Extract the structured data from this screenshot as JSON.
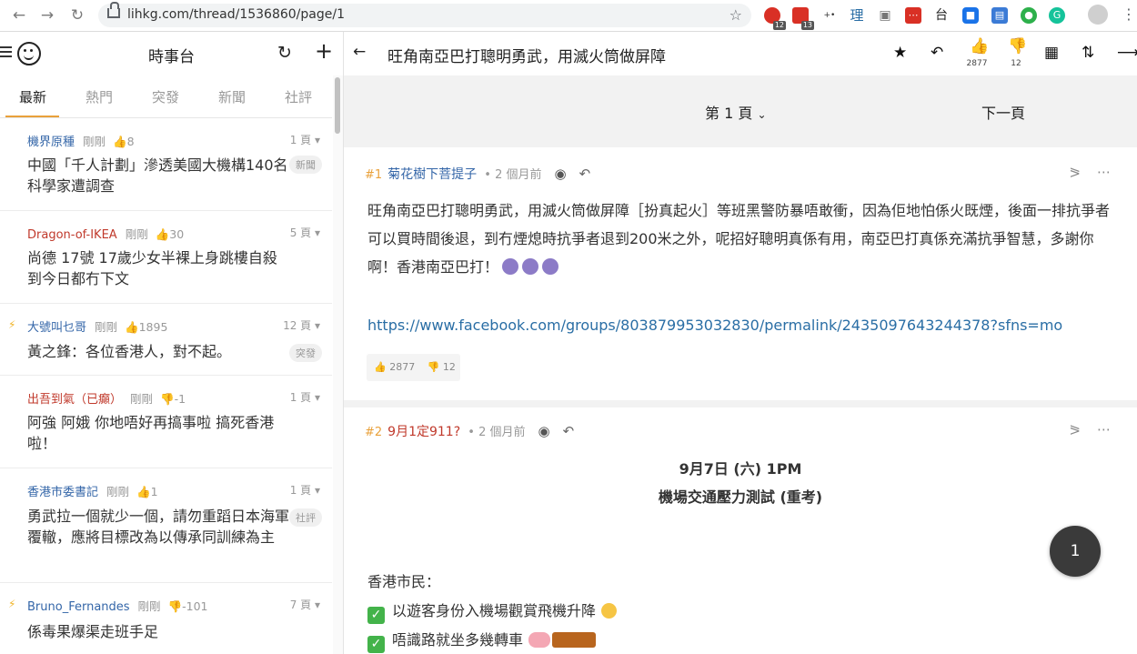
{
  "browser": {
    "url": "lihkg.com/thread/1536860/page/1",
    "ext_badges": [
      "12",
      "13"
    ],
    "ext_text": [
      "理",
      "台"
    ]
  },
  "sidebar": {
    "channel_title": "時事台",
    "tabs": [
      "最新",
      "熱門",
      "突發",
      "新聞",
      "社評"
    ],
    "threads": [
      {
        "user": "機界原種",
        "user_color": "#3466a8",
        "time": "剛剛",
        "likes": "8",
        "pages": "1 頁",
        "title": "中國「千人計劃」滲透美國大機構140名科學家遭調查",
        "tag": "新聞",
        "hot": false
      },
      {
        "user": "Dragon-of-IKEA",
        "user_color": "#c0392b",
        "time": "剛剛",
        "likes": "30",
        "pages": "5 頁",
        "title": "尚德 17號 17歲少女半裸上身跳樓自殺到今日都冇下文",
        "tag": "",
        "hot": false
      },
      {
        "user": "大號叫乜哥",
        "user_color": "#3466a8",
        "time": "剛剛",
        "likes": "1895",
        "pages": "12 頁",
        "title": "黃之鋒：各位香港人，對不起。",
        "tag": "突發",
        "hot": true
      },
      {
        "user": "出吾到氣（已癲）",
        "user_color": "#c0392b",
        "time": "剛剛",
        "likes": "-1",
        "pages": "1 頁",
        "title": "阿強 阿娥 你地唔好再搞事啦 搞死香港啦！",
        "tag": "",
        "hot": false
      },
      {
        "user": "香港市委書記",
        "user_color": "#3466a8",
        "time": "剛剛",
        "likes": "1",
        "pages": "1 頁",
        "title": "勇武拉一個就少一個，請勿重蹈日本海軍覆轍，應將目標改為以傳承同訓練為主",
        "tag": "社評",
        "hot": false
      },
      {
        "user": "Bruno_Fernandes",
        "user_color": "#3466a8",
        "time": "剛剛",
        "likes": "-101",
        "pages": "7 頁",
        "title": "係毒果爆渠走班手足",
        "tag": "",
        "hot": true
      }
    ]
  },
  "thread": {
    "title": "旺角南亞巴打聰明勇武，用滅火筒做屏障",
    "like_count": "2877",
    "dislike_count": "12",
    "page_label": "第 1 頁",
    "next_page": "下一頁",
    "posts": [
      {
        "floor": "#1",
        "user": "菊花樹下菩提子",
        "time": "2 個月前",
        "text": "旺角南亞巴打聰明勇武，用滅火筒做屏障［扮真起火］等班黑警防暴唔敢衝，因為佢地怕係火既煙，後面一排抗爭者可以買時間後退，到冇煙熄時抗爭者退到200米之外，呢招好聰明真係有用，南亞巴打真係充滿抗爭智慧，多謝你啊！香港南亞巴打！",
        "link": "https://www.facebook.com/groups/803879953032830/permalink/2435097643244378?sfns=mo",
        "likes": "2877",
        "dislikes": "12"
      },
      {
        "floor": "#2",
        "user": "9月1定911?",
        "time": "2 個月前",
        "heading1": "9月7日 (六) 1PM",
        "heading2": "機場交通壓力測試 (重考)",
        "line1": "香港市民：",
        "check1": "以遊客身份入機場觀賞飛機升降",
        "check2": "唔識路就坐多幾轉車"
      }
    ],
    "fab_label": "1"
  }
}
